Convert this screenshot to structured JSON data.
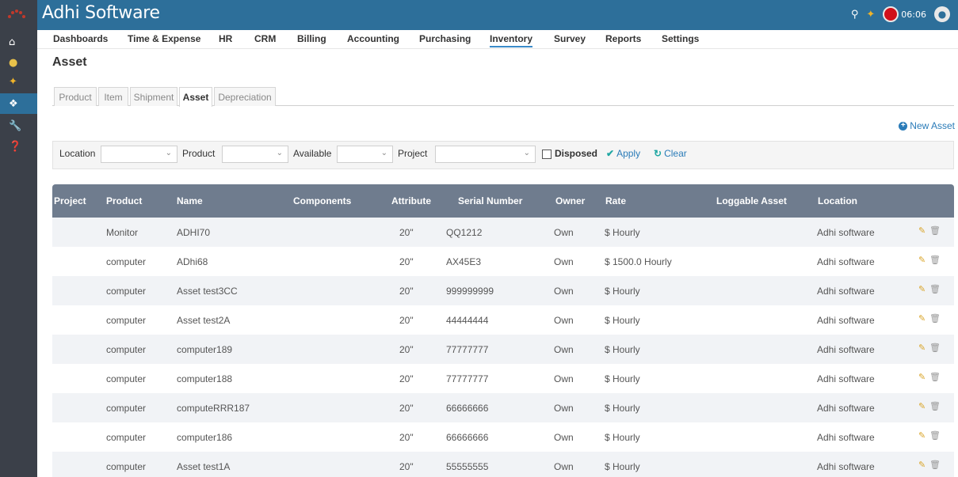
{
  "app": {
    "title": "Adhi Software",
    "time": "06:06"
  },
  "nav": [
    "Dashboards",
    "Time & Expense",
    "HR",
    "CRM",
    "Billing",
    "Accounting",
    "Purchasing",
    "Inventory",
    "Survey",
    "Reports",
    "Settings"
  ],
  "nav_active": "Inventory",
  "page": {
    "title": "Asset",
    "new_asset": "New Asset"
  },
  "subtabs": [
    "Product",
    "Item",
    "Shipment",
    "Asset",
    "Depreciation"
  ],
  "subtab_active": "Asset",
  "filters": {
    "location_label": "Location",
    "product_label": "Product",
    "available_label": "Available",
    "project_label": "Project",
    "disposed_label": "Disposed",
    "apply_label": "Apply",
    "clear_label": "Clear"
  },
  "table": {
    "headers": [
      "Project",
      "Product",
      "Name",
      "Components",
      "Attribute",
      "Serial Number",
      "Owner",
      "Rate",
      "Loggable Asset",
      "Location"
    ],
    "rows": [
      {
        "project": "",
        "product": "Monitor",
        "name": "ADHI70",
        "components": "",
        "attribute": "20\"",
        "serial": "QQ1212",
        "owner": "Own",
        "rate": "$ Hourly",
        "loggable": "",
        "location": "Adhi software"
      },
      {
        "project": "",
        "product": "computer",
        "name": "ADhi68",
        "components": "",
        "attribute": "20\"",
        "serial": "AX45E3",
        "owner": "Own",
        "rate": "$ 1500.0 Hourly",
        "loggable": "",
        "location": "Adhi software"
      },
      {
        "project": "",
        "product": "computer",
        "name": "Asset test3CC",
        "components": "",
        "attribute": "20\"",
        "serial": "999999999",
        "owner": "Own",
        "rate": "$ Hourly",
        "loggable": "",
        "location": "Adhi software"
      },
      {
        "project": "",
        "product": "computer",
        "name": "Asset test2A",
        "components": "",
        "attribute": "20\"",
        "serial": "44444444",
        "owner": "Own",
        "rate": "$ Hourly",
        "loggable": "",
        "location": "Adhi software"
      },
      {
        "project": "",
        "product": "computer",
        "name": "computer189",
        "components": "",
        "attribute": "20\"",
        "serial": "77777777",
        "owner": "Own",
        "rate": "$ Hourly",
        "loggable": "",
        "location": "Adhi software"
      },
      {
        "project": "",
        "product": "computer",
        "name": "computer188",
        "components": "",
        "attribute": "20\"",
        "serial": "77777777",
        "owner": "Own",
        "rate": "$ Hourly",
        "loggable": "",
        "location": "Adhi software"
      },
      {
        "project": "",
        "product": "computer",
        "name": "computeRRR187",
        "components": "",
        "attribute": "20\"",
        "serial": "66666666",
        "owner": "Own",
        "rate": "$ Hourly",
        "loggable": "",
        "location": "Adhi software"
      },
      {
        "project": "",
        "product": "computer",
        "name": "computer186",
        "components": "",
        "attribute": "20\"",
        "serial": "66666666",
        "owner": "Own",
        "rate": "$ Hourly",
        "loggable": "",
        "location": "Adhi software"
      },
      {
        "project": "",
        "product": "computer",
        "name": "Asset test1A",
        "components": "",
        "attribute": "20\"",
        "serial": "55555555",
        "owner": "Own",
        "rate": "$ Hourly",
        "loggable": "",
        "location": "Adhi software"
      }
    ]
  },
  "colors": {
    "topbar": "#2d6f9a",
    "sidebar": "#3b4049",
    "table_header": "#6f7c8e",
    "link": "#2a7bb8",
    "accent": "#21a7a3"
  }
}
